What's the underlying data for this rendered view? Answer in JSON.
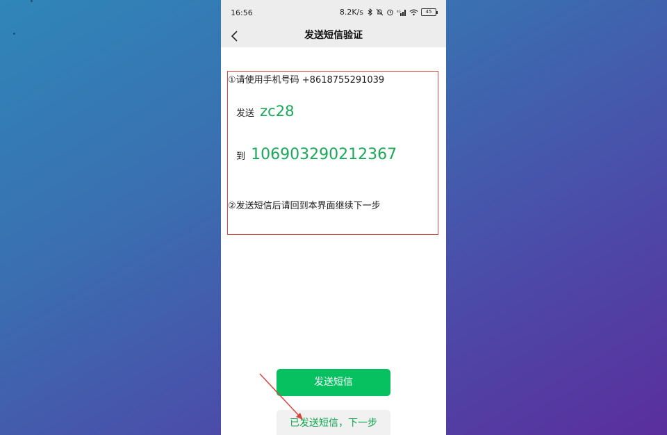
{
  "status_bar": {
    "time": "16:56",
    "network_speed": "8.2K/s",
    "battery_level": "45",
    "icons": [
      "bluetooth-icon",
      "mute-icon",
      "alarm-icon",
      "signal-icon",
      "wifi-icon",
      "battery-icon"
    ]
  },
  "header": {
    "title": "发送短信验证"
  },
  "instructions": {
    "step1": "①请使用手机号码 +8618755291039",
    "send_label": "发送",
    "code": "zc28",
    "to_label": "到",
    "recipient": "106903290212367",
    "step2": "②发送短信后请回到本界面继续下一步"
  },
  "buttons": {
    "send_sms": "发送短信",
    "sent_next": "已发送短信，下一步"
  },
  "colors": {
    "accent_green": "#07c160",
    "highlight_red": "#d9463e",
    "text_green": "#18a858"
  }
}
